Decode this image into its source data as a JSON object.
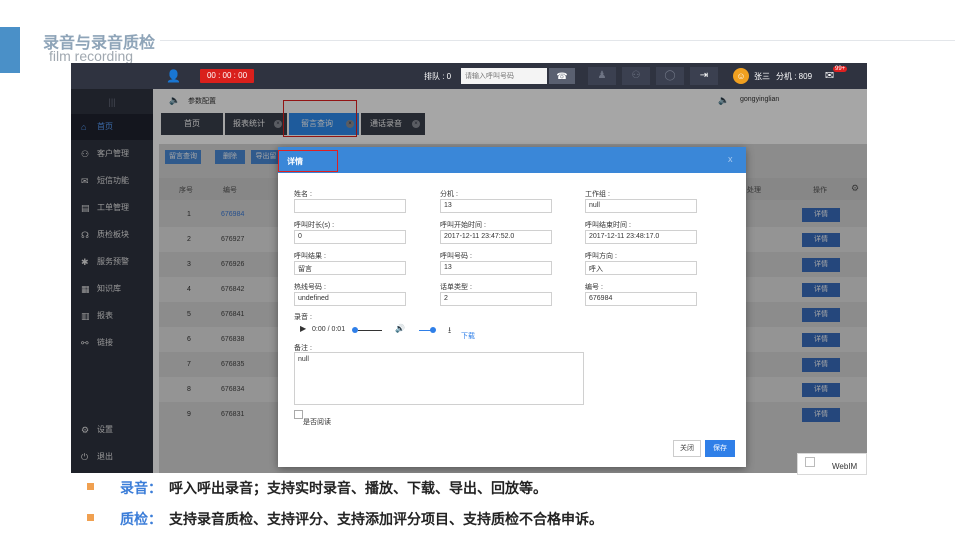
{
  "slide": {
    "title": "录音与录音质检",
    "subtitle": "film recording"
  },
  "topbar": {
    "timer": "00 : 00 : 00",
    "queue": "排队 : 0",
    "dial_placeholder": "请输入呼叫号码",
    "user_name": "张三",
    "extension": "分机 : 809",
    "mail_badge": "99+"
  },
  "sidebar": {
    "collapse_icon": "|||",
    "items": [
      {
        "label": "首页",
        "icon": "home-icon",
        "glyph": "⌂",
        "active": true
      },
      {
        "label": "客户管理",
        "icon": "customer-icon",
        "glyph": "⚇"
      },
      {
        "label": "短信功能",
        "icon": "sms-icon",
        "glyph": "✉"
      },
      {
        "label": "工单管理",
        "icon": "ticket-icon",
        "glyph": "▤"
      },
      {
        "label": "质检板块",
        "icon": "headset-icon",
        "glyph": "☊"
      },
      {
        "label": "服务预警",
        "icon": "alarm-icon",
        "glyph": "✱"
      },
      {
        "label": "知识库",
        "icon": "knowledge-icon",
        "glyph": "▦"
      },
      {
        "label": "报表",
        "icon": "chart-icon",
        "glyph": "▥"
      },
      {
        "label": "链接",
        "icon": "link-icon",
        "glyph": "⚯"
      }
    ],
    "settings_label": "设置",
    "logout_label": "退出"
  },
  "content": {
    "config_text": "参数配置",
    "username": "gongyinglian",
    "tabs": [
      {
        "label": "首页"
      },
      {
        "label": "报表统计"
      },
      {
        "label": "留言查询",
        "active": true
      },
      {
        "label": "通话录音"
      }
    ],
    "toolbar": [
      "留言查询",
      "删除",
      "导出留"
    ],
    "table_headers": {
      "seq": "序号",
      "id": "编号",
      "right": "处理",
      "op": "操作"
    },
    "rows": [
      {
        "no": "1",
        "id": "676984"
      },
      {
        "no": "2",
        "id": "676927"
      },
      {
        "no": "3",
        "id": "676926"
      },
      {
        "no": "4",
        "id": "676842"
      },
      {
        "no": "5",
        "id": "676841"
      },
      {
        "no": "6",
        "id": "676838"
      },
      {
        "no": "7",
        "id": "676835"
      },
      {
        "no": "8",
        "id": "676834"
      },
      {
        "no": "9",
        "id": "676831"
      }
    ],
    "detail_label": "详情"
  },
  "modal": {
    "title": "详情",
    "close_icon": "x",
    "fields": {
      "name_label": "姓名 :",
      "name_value": "",
      "ext_label": "分机 :",
      "ext_value": "13",
      "group_label": "工作组 :",
      "group_value": "null",
      "duration_label": "呼叫时长(s) :",
      "duration_value": "0",
      "start_label": "呼叫开始时间 :",
      "start_value": "2017-12-11 23:47:52.0",
      "end_label": "呼叫结束时间 :",
      "end_value": "2017-12-11 23:48:17.0",
      "result_label": "呼叫结果 :",
      "result_value": "留言",
      "number_label": "呼叫号码 :",
      "number_value": "13",
      "direction_label": "呼叫方向 :",
      "direction_value": "呼入",
      "hotline_label": "热线号码 :",
      "hotline_value": "undefined",
      "type_label": "话单类型 :",
      "type_value": "2",
      "code_label": "编号 :",
      "code_value": "676984"
    },
    "recording_label": "录音 :",
    "audio_time": "0:00 / 0:01",
    "download_label": "下载",
    "note_label": "备注 :",
    "note_value": "null",
    "read_label": "是否阅读",
    "close_button": "关闭",
    "save_button": "保存"
  },
  "webim": {
    "label": "WebIM"
  },
  "bullets": [
    {
      "term": "录音：",
      "text": "呼入呼出录音；支持实时录音、播放、下载、导出、回放等。"
    },
    {
      "term": "质检：",
      "text": "支持录音质检、支持评分、支持添加评分项目、支持质检不合格申诉。"
    }
  ],
  "colors": {
    "accent": "#4a90c8",
    "primary": "#2f7fe8",
    "sidebar": "#2f3340",
    "highlight": "#e02020",
    "bullet": "#f0a050"
  }
}
